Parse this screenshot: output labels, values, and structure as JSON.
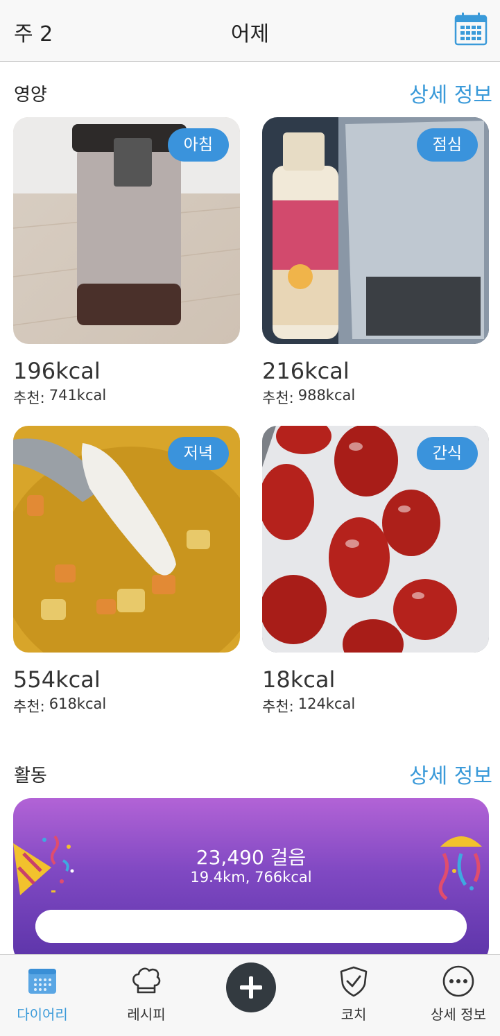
{
  "header": {
    "week_label": "주 2",
    "title": "어제"
  },
  "nutrition": {
    "section_title": "영양",
    "details_link": "상세 정보",
    "meals": [
      {
        "badge": "아침",
        "kcal": "196kcal",
        "rec_label": "추천:",
        "rec_value": "741kcal"
      },
      {
        "badge": "점심",
        "kcal": "216kcal",
        "rec_label": "추천:",
        "rec_value": "988kcal"
      },
      {
        "badge": "저녁",
        "kcal": "554kcal",
        "rec_label": "추천:",
        "rec_value": "618kcal"
      },
      {
        "badge": "간식",
        "kcal": "18kcal",
        "rec_label": "추천:",
        "rec_value": "124kcal"
      }
    ]
  },
  "activity": {
    "section_title": "활동",
    "details_link": "상세 정보",
    "steps": "23,490 걸음",
    "summary": "19.4km, 766kcal",
    "progress": 1.0
  },
  "tabbar": {
    "tabs": [
      {
        "label": "다이어리",
        "icon": "calendar-icon",
        "active": true
      },
      {
        "label": "레시피",
        "icon": "chef-hat-icon",
        "active": false
      },
      {
        "label": "코치",
        "icon": "shield-check-icon",
        "active": false
      },
      {
        "label": "상세 정보",
        "icon": "more-dots-icon",
        "active": false
      }
    ],
    "add_icon": "plus-icon"
  },
  "colors": {
    "accent": "#3a9ad9",
    "badge": "#3a93dc",
    "activity_gradient_top": "#b263d6",
    "activity_gradient_bottom": "#5b34a8",
    "add_button": "#333a40"
  }
}
